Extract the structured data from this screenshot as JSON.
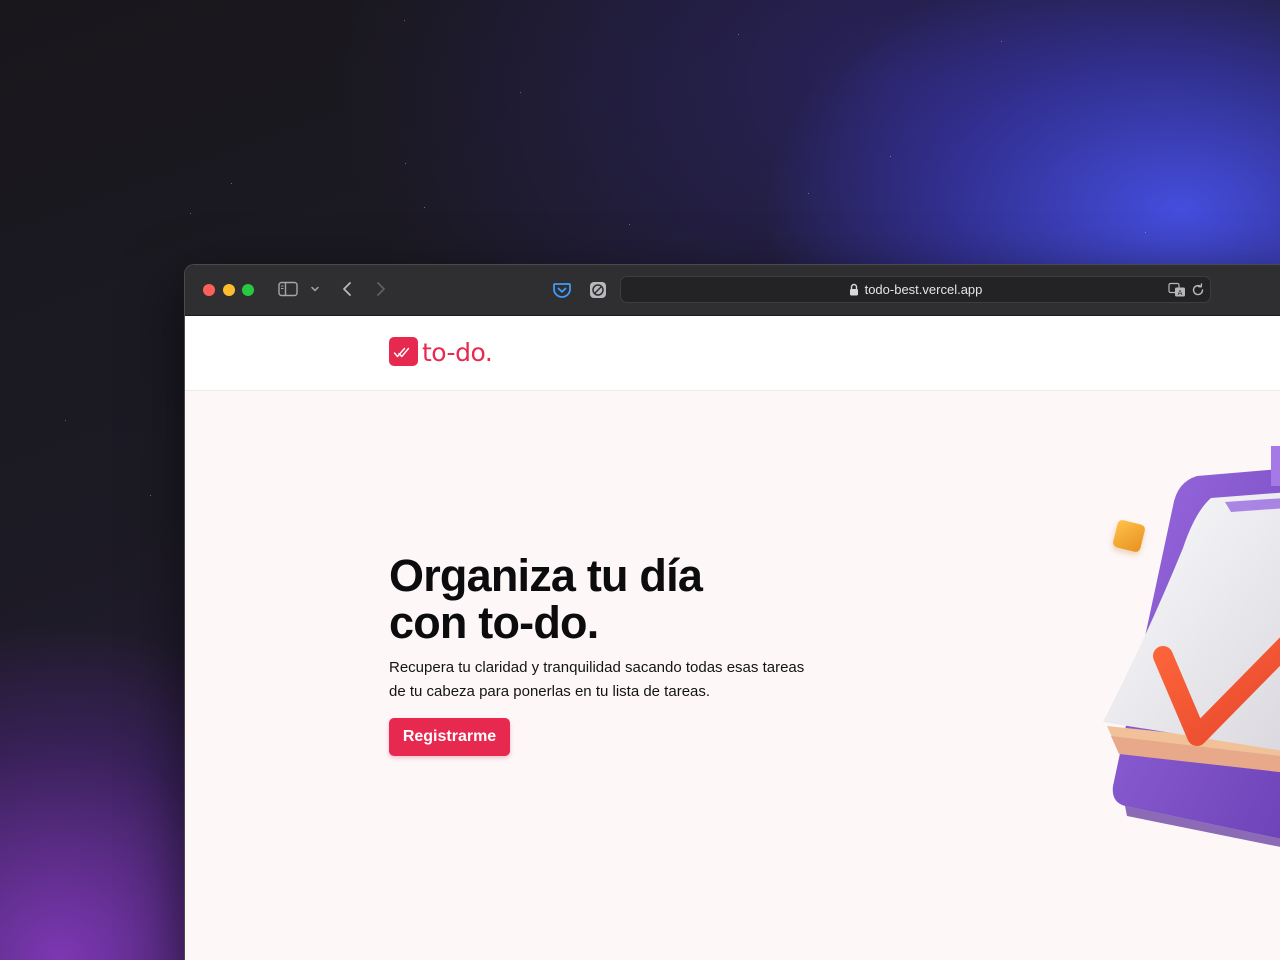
{
  "browser": {
    "url": "todo-best.vercel.app",
    "icons": {
      "close": "close-traffic-light",
      "minimize": "minimize-traffic-light",
      "zoom": "zoom-traffic-light",
      "sidebar": "sidebar-icon",
      "tab_chevron": "chevron-down-icon",
      "back": "back-arrow-icon",
      "forward": "forward-arrow-icon",
      "pocket": "pocket-icon",
      "extension": "extension-icon",
      "lock": "lock-icon",
      "translate": "translate-icon",
      "reload": "reload-icon"
    }
  },
  "site": {
    "logo_text": "to-do",
    "logo_dot": ".",
    "brand_color": "#e8294f"
  },
  "hero": {
    "title_line1": "Organiza tu día",
    "title_line2": "con to-do.",
    "description": "Recupera tu claridad y tranquilidad sacando todas esas tareas de tu cabeza para ponerlas en tu lista de tareas.",
    "cta_label": "Registrarme"
  },
  "colors": {
    "page_background": "#fdf7f8",
    "toolbar": "#2f2f31",
    "footer": "#0f1224"
  }
}
